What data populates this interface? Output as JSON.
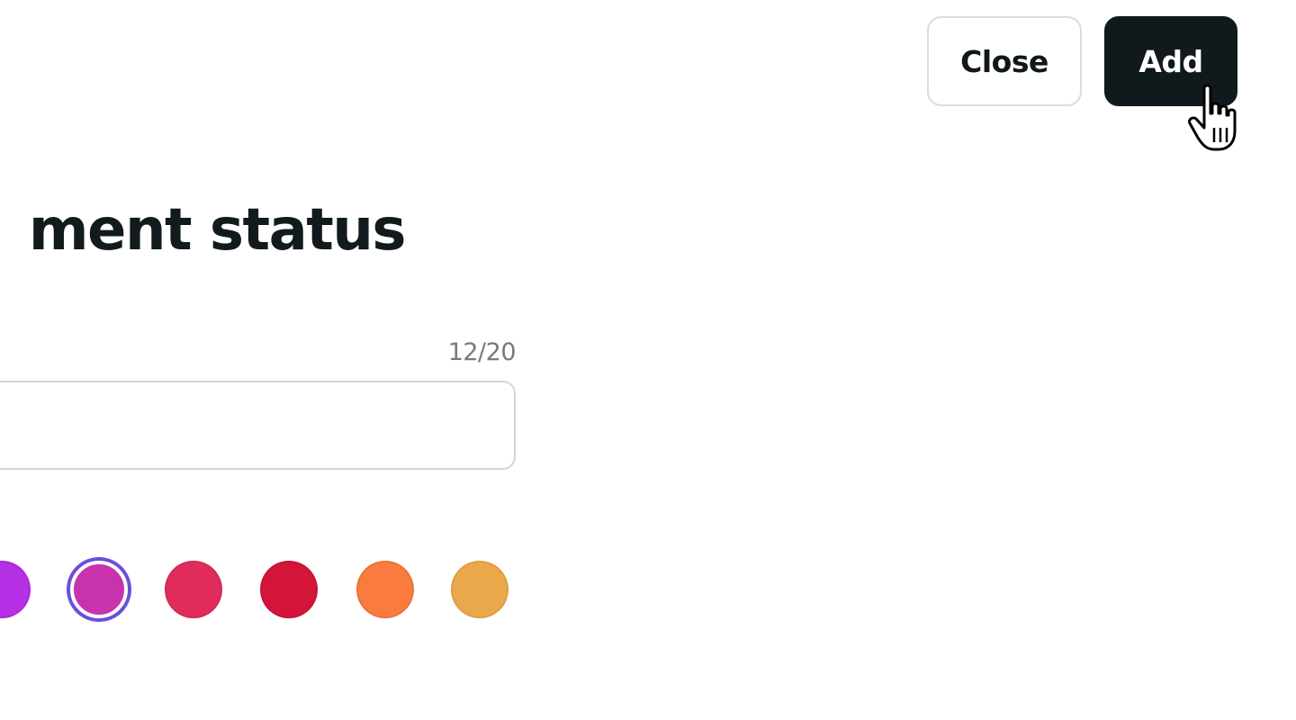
{
  "header": {
    "close_label": "Close",
    "add_label": "Add"
  },
  "form": {
    "title": "ment status",
    "char_counter": "12/20",
    "name_input": {
      "value": "",
      "placeholder": ""
    },
    "colors": [
      {
        "name": "purple",
        "hex": "#b52fe4",
        "selected": false
      },
      {
        "name": "magenta",
        "hex": "#c832ad",
        "selected": true
      },
      {
        "name": "pink-red",
        "hex": "#e02c5a",
        "selected": false
      },
      {
        "name": "crimson",
        "hex": "#d3153a",
        "selected": false
      },
      {
        "name": "orange",
        "hex": "#f97b3d",
        "selected": false
      },
      {
        "name": "amber",
        "hex": "#eba84b",
        "selected": false
      }
    ],
    "selection_ring_color": "#6b4fd8"
  },
  "cursor": {
    "icon": "hand-pointer-icon"
  }
}
